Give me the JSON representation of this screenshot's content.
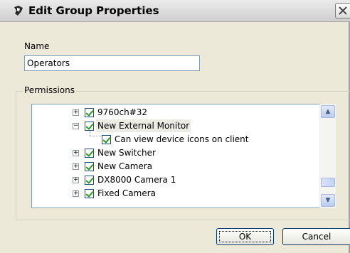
{
  "window": {
    "title": "Edit Group Properties",
    "close_icon": "close-icon",
    "app_icon": "group-properties-icon"
  },
  "name_field": {
    "label": "Name",
    "value": "Operators"
  },
  "permissions": {
    "label": "Permissions",
    "items": [
      {
        "label": "9760ch#32",
        "checked": true,
        "expander": "+"
      },
      {
        "label": "New External Monitor",
        "checked": true,
        "expander": "−",
        "selected": true
      },
      {
        "label": "Can view device icons on client",
        "checked": true,
        "expander": null,
        "child": true
      },
      {
        "label": "New Switcher",
        "checked": true,
        "expander": "+"
      },
      {
        "label": "New Camera",
        "checked": true,
        "expander": "+"
      },
      {
        "label": "DX8000 Camera 1",
        "checked": true,
        "expander": "+"
      },
      {
        "label": "Fixed Camera",
        "checked": true,
        "expander": "+"
      }
    ]
  },
  "buttons": {
    "ok": "OK",
    "cancel": "Cancel"
  }
}
